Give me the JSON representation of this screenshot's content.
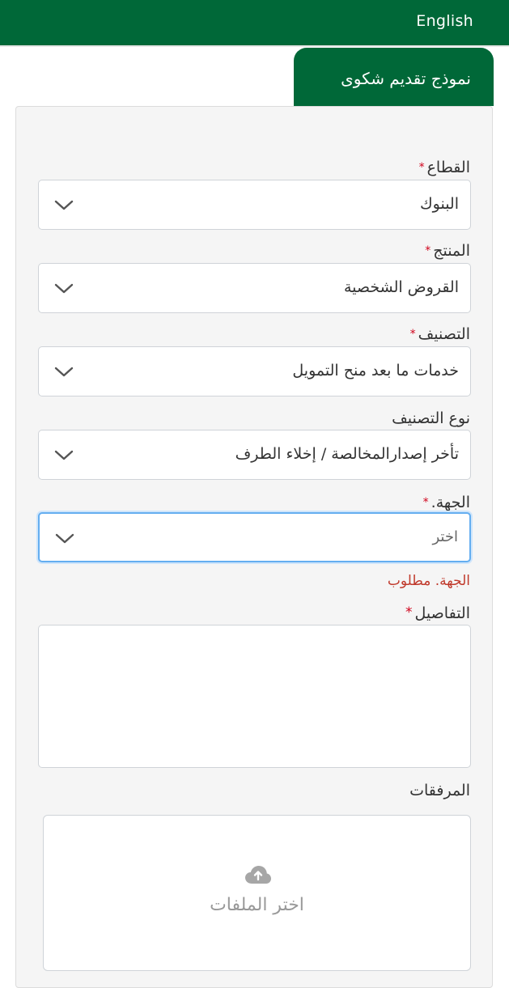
{
  "header": {
    "language_link": "English",
    "brand_color": "#006838"
  },
  "form": {
    "tab_title": "نموذج تقديم شكوى",
    "required_mark": "*",
    "fields": {
      "sector": {
        "label": "القطاع",
        "value": "البنوك",
        "required": true
      },
      "product": {
        "label": "المنتج",
        "value": "القروض الشخصية",
        "required": true
      },
      "category": {
        "label": "التصنيف",
        "value": "خدمات ما بعد منح التمويل",
        "required": true
      },
      "category_type": {
        "label": "نوع التصنيف",
        "value": "تأخر إصدارالمخالصة / إخلاء الطرف",
        "required": false
      },
      "entity": {
        "label": "الجهة.",
        "value": "اختر",
        "required": true,
        "error": "الجهة. مطلوب",
        "focused": true
      },
      "details": {
        "label": "التفاصيل",
        "value": "",
        "required": true
      },
      "attachments": {
        "label": "المرفقات",
        "button_label": "اختر الملفات",
        "icon": "cloud-upload-icon"
      }
    },
    "error_color": "#c0392b",
    "focus_color": "#64aef0"
  }
}
